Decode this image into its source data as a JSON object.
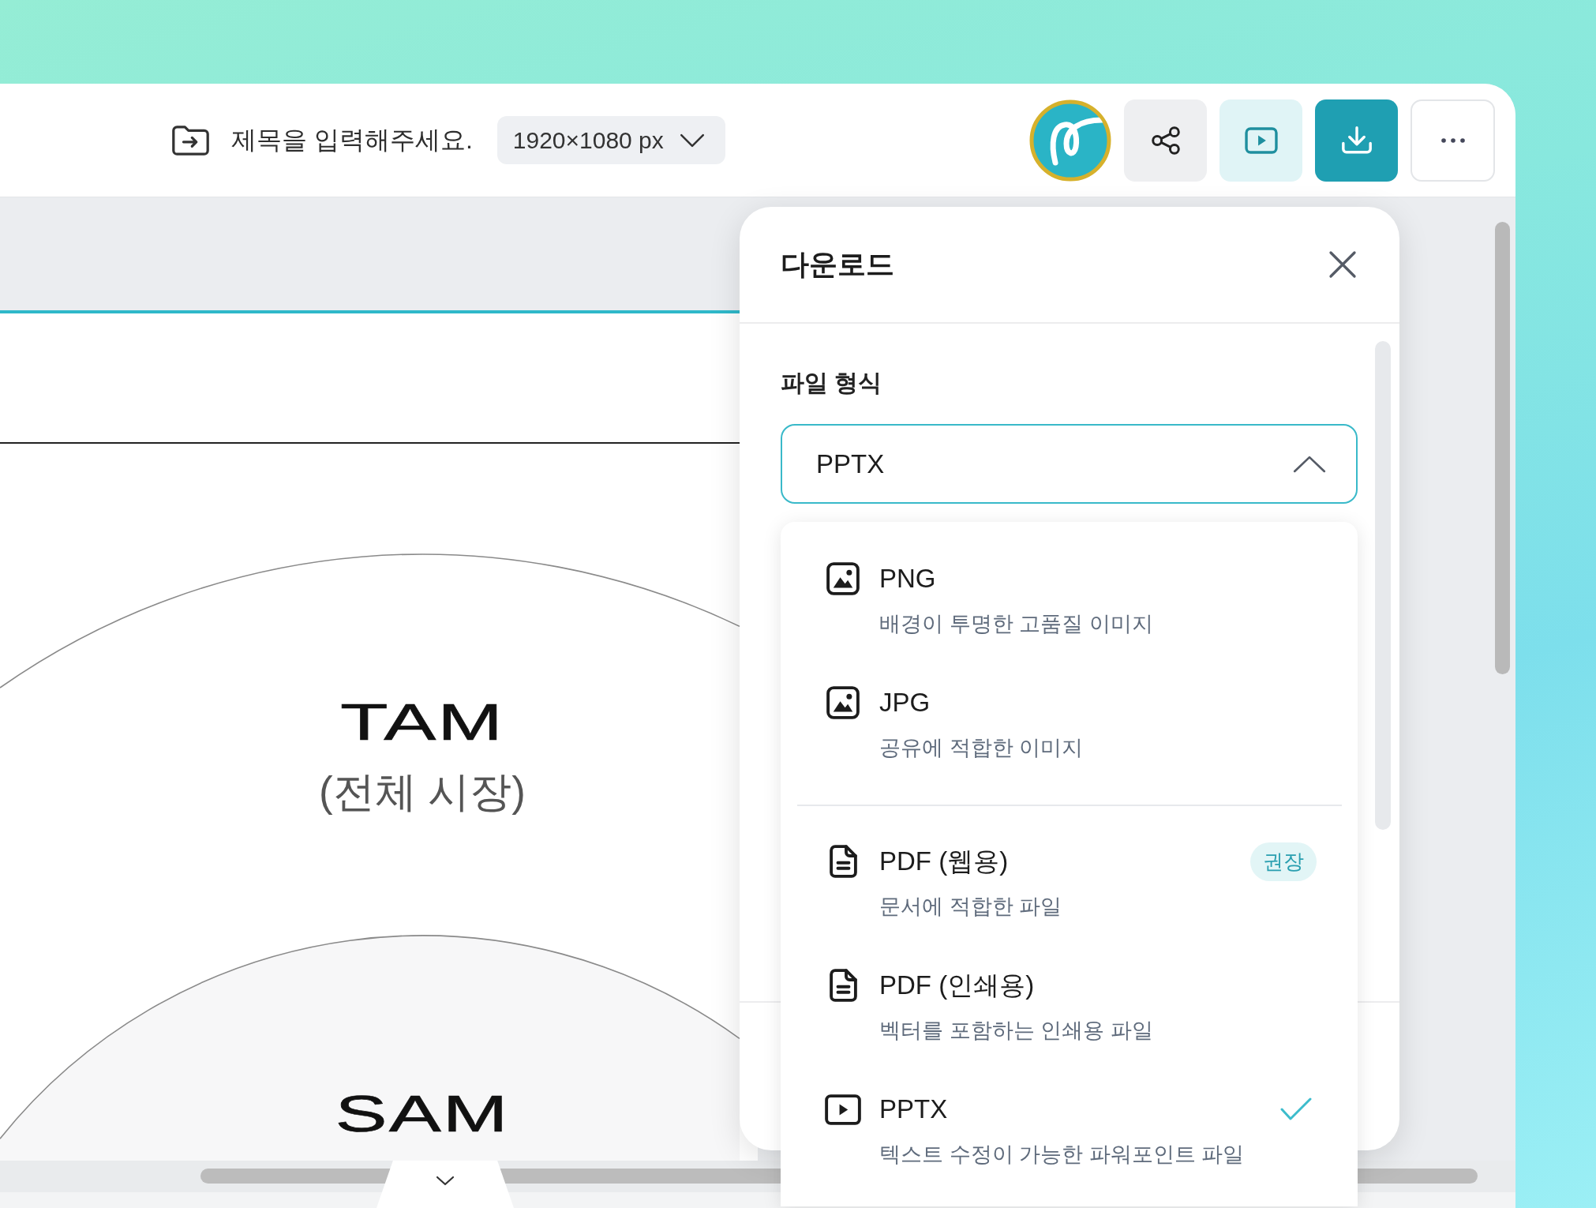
{
  "toolbar": {
    "document_title": "제목을 입력해주세요.",
    "canvas_size": "1920×1080 px"
  },
  "slide": {
    "circles": [
      {
        "title": "TAM",
        "subtitle": "(전체 시장)"
      },
      {
        "title": "SAM"
      }
    ]
  },
  "download_panel": {
    "title": "다운로드",
    "file_format": {
      "label": "파일 형식",
      "value": "PPTX",
      "expanded": true
    },
    "option_groups": [
      {
        "options": [
          {
            "kind": "image",
            "name": "PNG",
            "description": "배경이 투명한 고품질 이미지",
            "selected": false
          },
          {
            "kind": "image",
            "name": "JPG",
            "description": "공유에 적합한 이미지",
            "selected": false
          }
        ]
      },
      {
        "options": [
          {
            "kind": "document",
            "name": "PDF (웹용)",
            "description": "문서에 적합한 파일",
            "badge": "권장",
            "selected": false
          },
          {
            "kind": "document",
            "name": "PDF (인쇄용)",
            "description": "벡터를 포함하는 인쇄용 파일",
            "selected": false
          },
          {
            "kind": "slides",
            "name": "PPTX",
            "description": "텍스트 수정이 가능한 파워포인트 파일",
            "selected": true
          }
        ]
      }
    ]
  }
}
